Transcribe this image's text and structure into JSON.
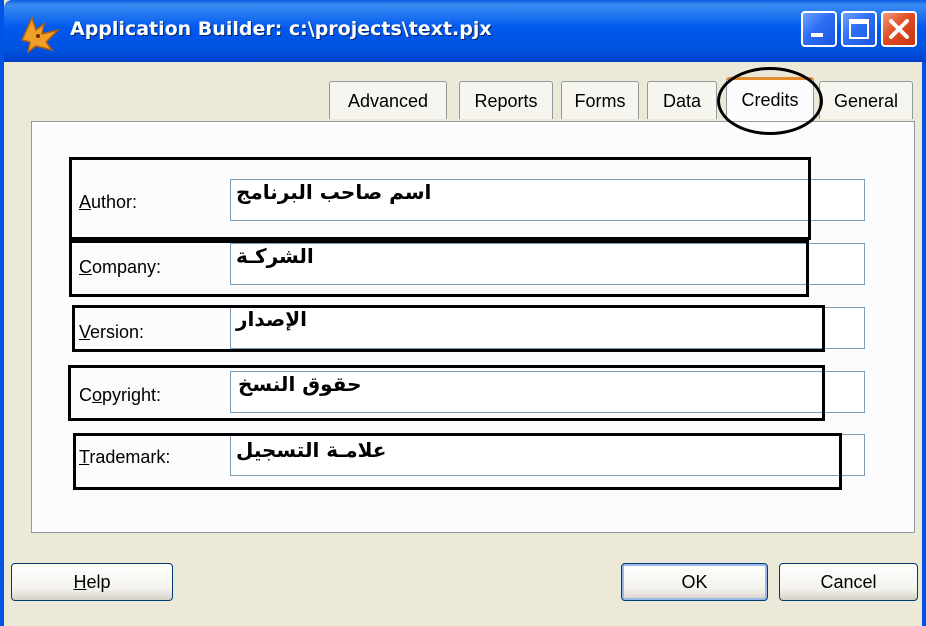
{
  "window": {
    "title": "Application Builder: c:\\projects\\text.pjx"
  },
  "titlebar_buttons": [
    "minimize-icon",
    "maximize-icon",
    "close-icon"
  ],
  "tabs": [
    {
      "label": "Advanced"
    },
    {
      "label": "Reports"
    },
    {
      "label": "Forms"
    },
    {
      "label": "Data"
    },
    {
      "label": "Credits",
      "active": true
    },
    {
      "label": "General"
    }
  ],
  "fields": [
    {
      "label": "Author:",
      "accel": "A",
      "rest": "uthor:",
      "value": "اسم صاحب البرنامج"
    },
    {
      "label": "Company:",
      "accel": "C",
      "rest": "ompany:",
      "value": "الشركـة"
    },
    {
      "label": "Version:",
      "accel": "V",
      "rest": "ersion:",
      "value": "الإصدار"
    },
    {
      "label": "Copyright:",
      "pre": "C",
      "accel": "o",
      "rest": "pyright:",
      "value": "حقوق النسخ"
    },
    {
      "label": "Trademark:",
      "accel": "T",
      "rest": "rademark:",
      "value": "علامـة التسجيل"
    }
  ],
  "buttons": {
    "help": {
      "accel": "H",
      "rest": "elp"
    },
    "ok": "OK",
    "cancel": "Cancel"
  },
  "colors": {
    "titlebar": "#0058ee",
    "dialog_bg": "#ece9d8",
    "tab_active_accent": "#e68b2c",
    "annotation": "#000000"
  }
}
